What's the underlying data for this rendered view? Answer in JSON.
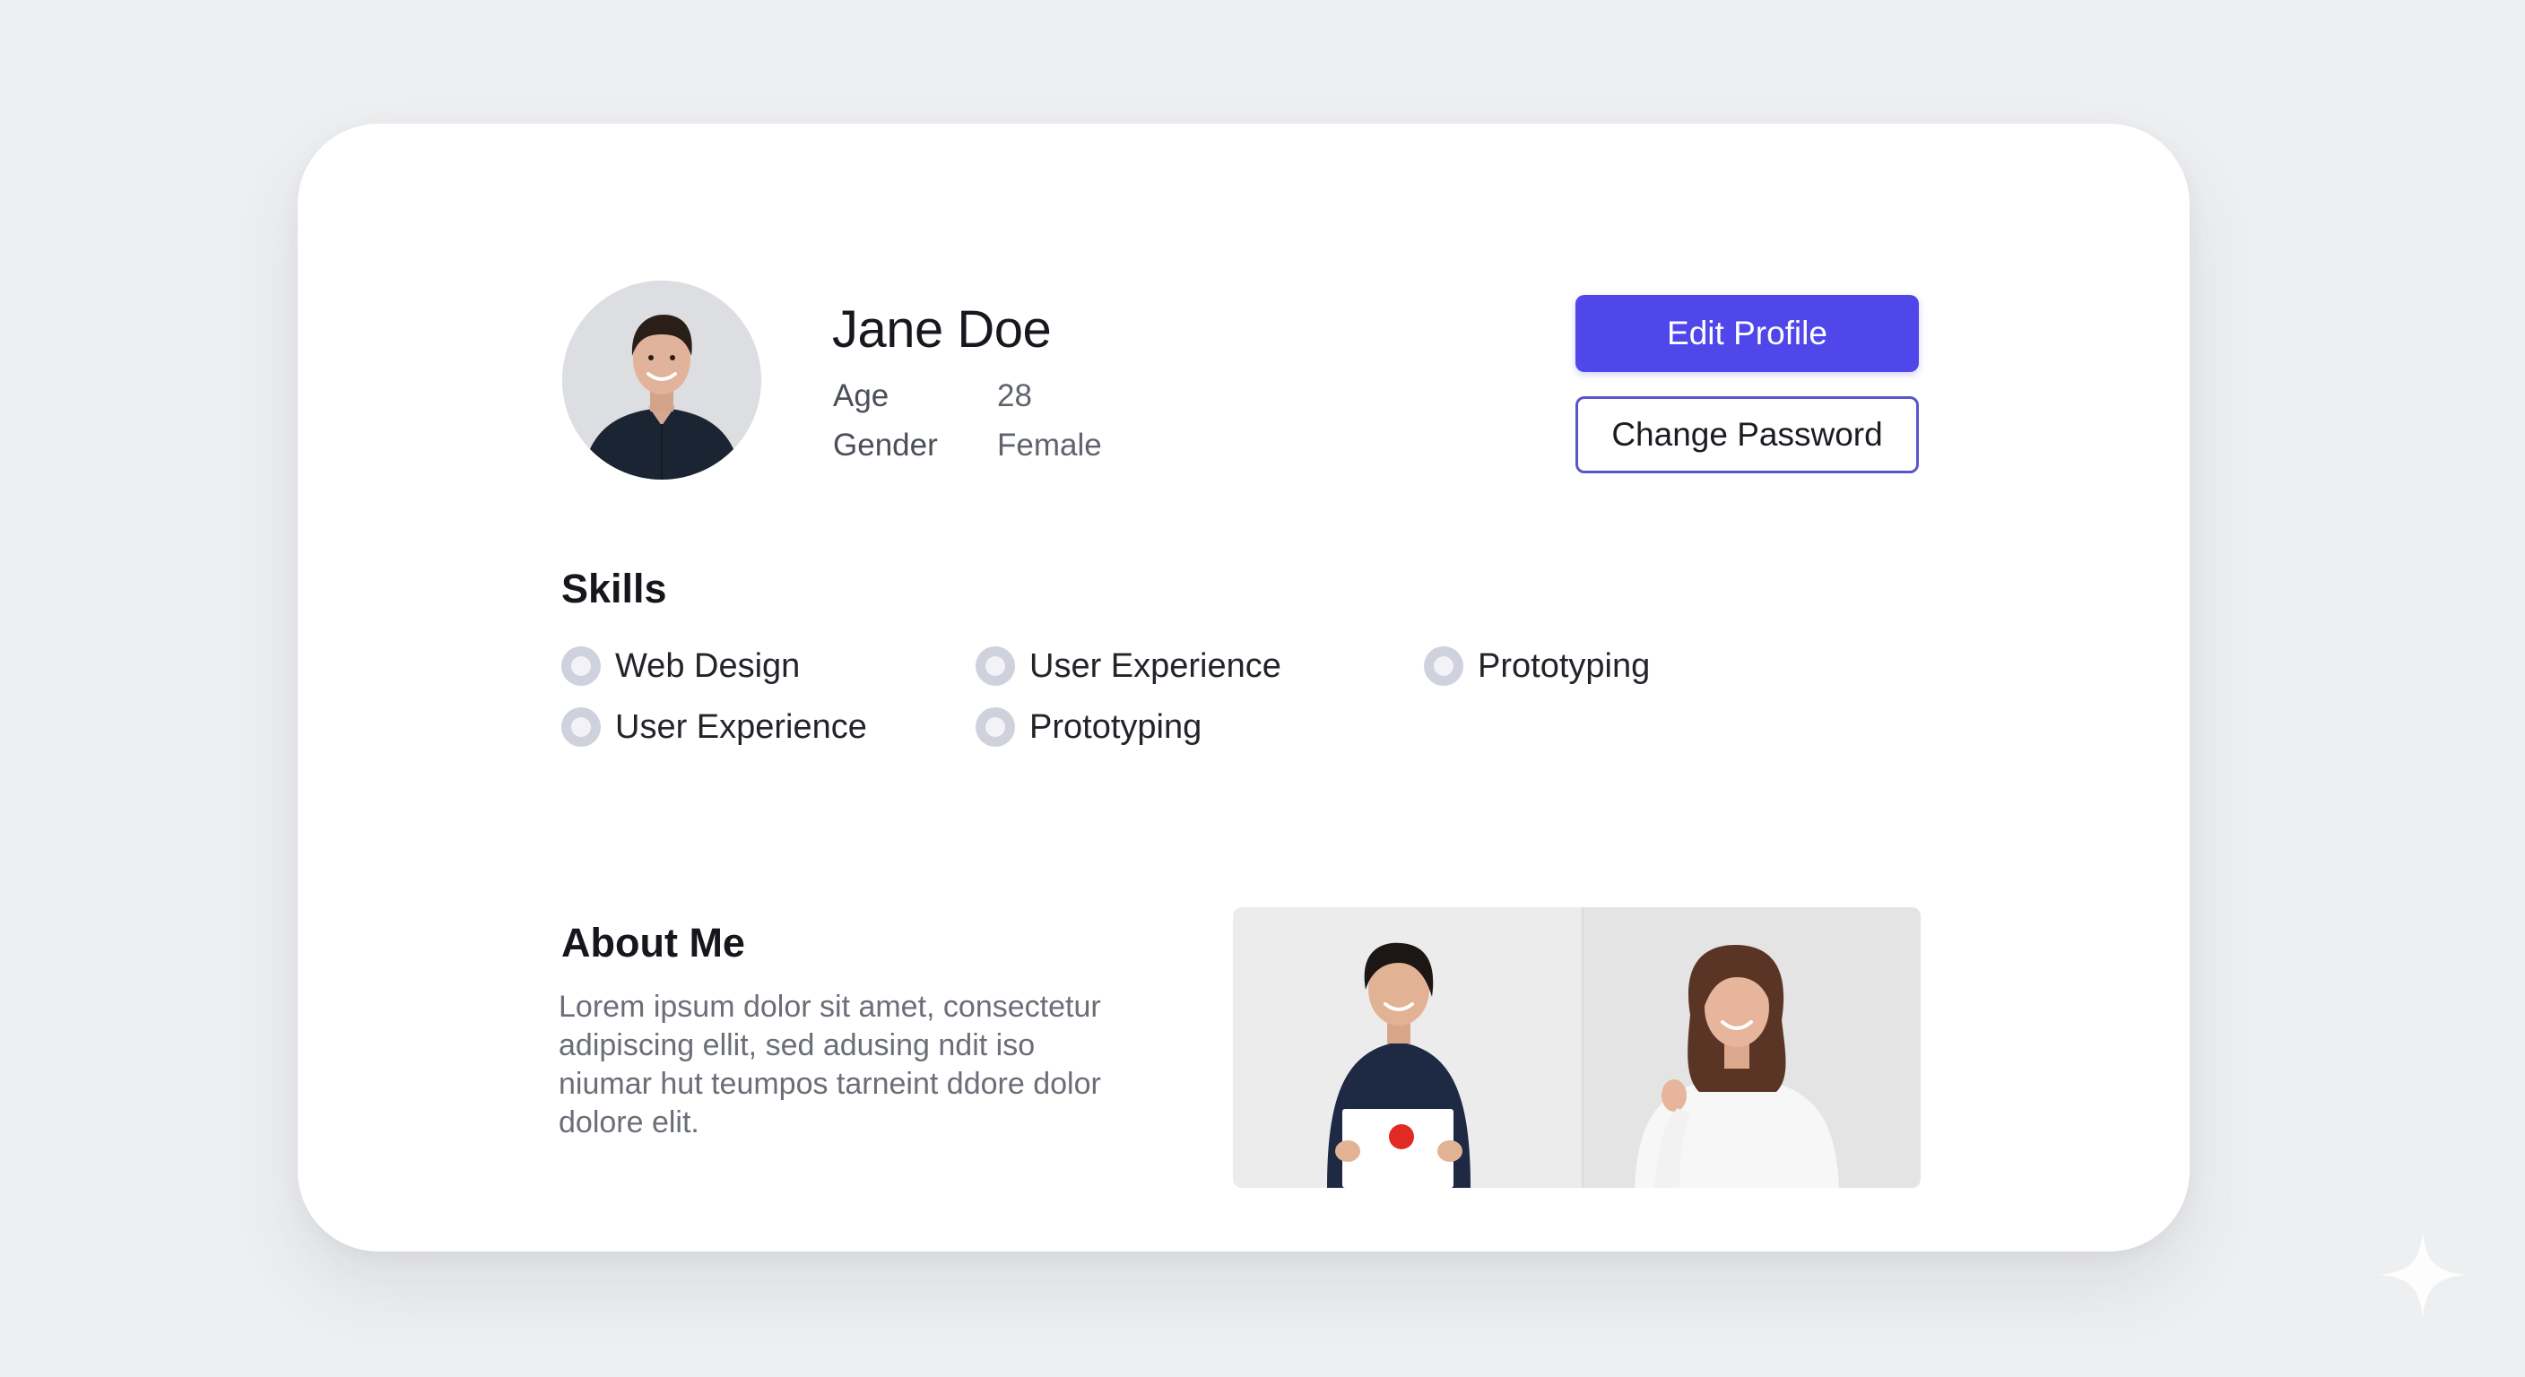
{
  "profile": {
    "name": "Jane Doe",
    "age_label": "Age",
    "age_value": "28",
    "gender_label": "Gender",
    "gender_value": "Female",
    "avatar_alt": "profile photo"
  },
  "actions": {
    "edit_profile": "Edit Profile",
    "change_password": "Change Password"
  },
  "skills": {
    "title": "Skills",
    "items": [
      {
        "label": "Web Design"
      },
      {
        "label": "User Experience"
      },
      {
        "label": "Prototyping"
      },
      {
        "label": "User Experience"
      },
      {
        "label": "Prototyping"
      }
    ]
  },
  "about": {
    "title": "About Me",
    "lines": [
      "Lorem ipsum dolor sit amet, consectetur",
      "adipiscing ellit, sed adusing ndit  iso",
      "niumar hut teumpos tarneint ddore dolor",
      "dolore elit."
    ]
  },
  "colors": {
    "accent": "#5047ea",
    "outline": "#5a55c8",
    "background": "#eeeff1",
    "card": "#ffffff"
  },
  "icons": {
    "skill_marker": "radio-icon",
    "corner_mark": "sparkle-icon"
  }
}
